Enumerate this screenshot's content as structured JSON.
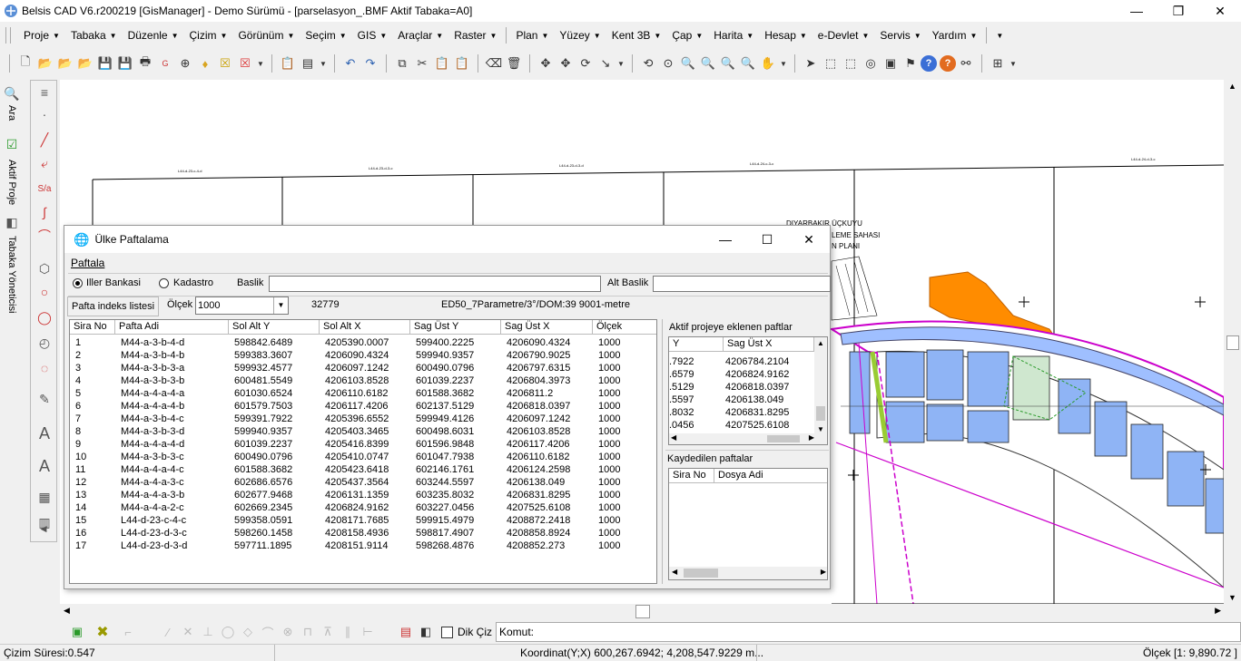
{
  "window": {
    "title": "Belsis CAD V6.r200219 [GisManager] - Demo Sürümü - [parselasyon_.BMF  Aktif Tabaka=A0]"
  },
  "menu": [
    {
      "label": "Proje"
    },
    {
      "label": "Tabaka"
    },
    {
      "label": "Düzenle"
    },
    {
      "label": "Çizim"
    },
    {
      "label": "Görünüm"
    },
    {
      "label": "Seçim"
    },
    {
      "label": "GIS"
    },
    {
      "label": "Araçlar"
    },
    {
      "label": "Raster"
    },
    {
      "label": "Plan"
    },
    {
      "label": "Yüzey"
    },
    {
      "label": "Kent 3B"
    },
    {
      "label": "Çap"
    },
    {
      "label": "Harita"
    },
    {
      "label": "Hesap"
    },
    {
      "label": "e-Devlet"
    },
    {
      "label": "Servis"
    },
    {
      "label": "Yardım"
    }
  ],
  "left_panel": {
    "ara": "Ara",
    "aktif_proje": "Aktif Proje",
    "tabaka": "Tabaka Yöneticisi"
  },
  "canvas": {
    "labels": [
      "DIYARBAKIR ÜÇKUYU",
      "LEME SAHASI",
      "N PLANI"
    ]
  },
  "dialog": {
    "title": "Ülke Paftalama",
    "section": "Paftala",
    "radio1": "Iller Bankasi",
    "radio2": "Kadastro",
    "baslik_label": "Baslik",
    "baslik_value": "",
    "alt_baslik_label": "Alt Baslik",
    "alt_baslik_value": "",
    "index_btn": "Pafta indeks listesi",
    "olcek_label": "Ölçek",
    "olcek_value": "1000",
    "code": "32779",
    "projection": "ED50_7Parametre/3°/DOM:39  9001-metre",
    "columns": [
      "Sira No",
      "Pafta Adi",
      "Sol Alt Y",
      "Sol Alt X",
      "Sag Üst Y",
      "Sag Üst X",
      "Ölçek"
    ],
    "rows": [
      [
        "1",
        "M44-a-3-b-4-d",
        "598842.6489",
        "4205390.0007",
        "599400.2225",
        "4206090.4324",
        "1000"
      ],
      [
        "2",
        "M44-a-3-b-4-b",
        "599383.3607",
        "4206090.4324",
        "599940.9357",
        "4206790.9025",
        "1000"
      ],
      [
        "3",
        "M44-a-3-b-3-a",
        "599932.4577",
        "4206097.1242",
        "600490.0796",
        "4206797.6315",
        "1000"
      ],
      [
        "4",
        "M44-a-3-b-3-b",
        "600481.5549",
        "4206103.8528",
        "601039.2237",
        "4206804.3973",
        "1000"
      ],
      [
        "5",
        "M44-a-4-a-4-a",
        "601030.6524",
        "4206110.6182",
        "601588.3682",
        "4206811.2",
        "1000"
      ],
      [
        "6",
        "M44-a-4-a-4-b",
        "601579.7503",
        "4206117.4206",
        "602137.5129",
        "4206818.0397",
        "1000"
      ],
      [
        "7",
        "M44-a-3-b-4-c",
        "599391.7922",
        "4205396.6552",
        "599949.4126",
        "4206097.1242",
        "1000"
      ],
      [
        "8",
        "M44-a-3-b-3-d",
        "599940.9357",
        "4205403.3465",
        "600498.6031",
        "4206103.8528",
        "1000"
      ],
      [
        "9",
        "M44-a-4-a-4-d",
        "601039.2237",
        "4205416.8399",
        "601596.9848",
        "4206117.4206",
        "1000"
      ],
      [
        "10",
        "M44-a-3-b-3-c",
        "600490.0796",
        "4205410.0747",
        "601047.7938",
        "4206110.6182",
        "1000"
      ],
      [
        "11",
        "M44-a-4-a-4-c",
        "601588.3682",
        "4205423.6418",
        "602146.1761",
        "4206124.2598",
        "1000"
      ],
      [
        "12",
        "M44-a-4-a-3-c",
        "602686.6576",
        "4205437.3564",
        "603244.5597",
        "4206138.049",
        "1000"
      ],
      [
        "13",
        "M44-a-4-a-3-b",
        "602677.9468",
        "4206131.1359",
        "603235.8032",
        "4206831.8295",
        "1000"
      ],
      [
        "14",
        "M44-a-4-a-2-c",
        "602669.2345",
        "4206824.9162",
        "603227.0456",
        "4207525.6108",
        "1000"
      ],
      [
        "15",
        "L44-d-23-c-4-c",
        "599358.0591",
        "4208171.7685",
        "599915.4979",
        "4208872.2418",
        "1000"
      ],
      [
        "16",
        "L44-d-23-d-3-c",
        "598260.1458",
        "4208158.4936",
        "598817.4907",
        "4208858.8924",
        "1000"
      ],
      [
        "17",
        "L44-d-23-d-3-d",
        "597711.1895",
        "4208151.9114",
        "598268.4876",
        "4208852.273",
        "1000"
      ]
    ],
    "aktif_title": "Aktif projeye eklenen paftlar",
    "aktif_columns": [
      "Y",
      "Sag Üst X"
    ],
    "aktif_rows": [
      [
        ".7922",
        "4206784.2104"
      ],
      [
        ".6579",
        "4206824.9162"
      ],
      [
        ".5129",
        "4206818.0397"
      ],
      [
        ".5597",
        "4206138.049"
      ],
      [
        ".8032",
        "4206831.8295"
      ],
      [
        ".0456",
        "4207525.6108"
      ]
    ],
    "kaydedilen_title": "Kaydedilen paftalar",
    "kaydedilen_columns": [
      "Sira No",
      "Dosya Adi"
    ]
  },
  "bottom": {
    "dik_ciz": "Dik Çiz",
    "komut": "Komut:"
  },
  "status": {
    "left": "Çizim Süresi:0.547",
    "coord": "Koordinat(Y;X)  600,267.6942; 4,208,547.9229 m...",
    "scale": "Ölçek [1: 9,890.72 ]"
  }
}
